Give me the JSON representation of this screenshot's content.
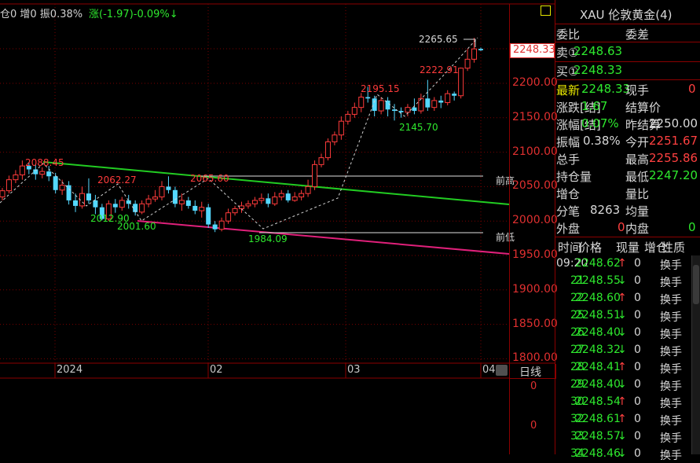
{
  "top_bar": {
    "text1": "仓0 增0 振0.38%",
    "text2": "涨(-1.97)-0.09%↓"
  },
  "price_axis": {
    "ticks": [
      "2200.00",
      "2150.00",
      "2100.00",
      "2050.00",
      "2000.00",
      "1950.00",
      "1900.00",
      "1850.00",
      "1800.00"
    ],
    "current_price": "2248.33",
    "lower_ticks": [
      "0",
      "0"
    ]
  },
  "date_axis": {
    "labels": [
      "2024",
      "02",
      "03",
      "04"
    ],
    "period_label": "日线"
  },
  "chart_annotations": {
    "high_label": "2265.65",
    "peak_labels": [
      "2222.91",
      "2195.15",
      "2088.45",
      "2062.27",
      "2065.60"
    ],
    "trough_labels": [
      "2145.70",
      "2012.90",
      "2001.60",
      "1984.09"
    ],
    "line_tags": [
      "前高",
      "前低"
    ]
  },
  "candles": [
    {
      "o": 2035,
      "c": 2044,
      "h": 2048,
      "l": 2030
    },
    {
      "o": 2044,
      "c": 2060,
      "h": 2066,
      "l": 2040
    },
    {
      "o": 2060,
      "c": 2067,
      "h": 2074,
      "l": 2055
    },
    {
      "o": 2067,
      "c": 2080,
      "h": 2088,
      "l": 2060
    },
    {
      "o": 2080,
      "c": 2075,
      "h": 2085,
      "l": 2068
    },
    {
      "o": 2075,
      "c": 2068,
      "h": 2082,
      "l": 2060
    },
    {
      "o": 2068,
      "c": 2072,
      "h": 2078,
      "l": 2062
    },
    {
      "o": 2072,
      "c": 2065,
      "h": 2080,
      "l": 2058
    },
    {
      "o": 2065,
      "c": 2045,
      "h": 2070,
      "l": 2040
    },
    {
      "o": 2045,
      "c": 2052,
      "h": 2060,
      "l": 2038
    },
    {
      "o": 2052,
      "c": 2030,
      "h": 2058,
      "l": 2024
    },
    {
      "o": 2030,
      "c": 2022,
      "h": 2040,
      "l": 2013
    },
    {
      "o": 2022,
      "c": 2040,
      "h": 2050,
      "l": 2018
    },
    {
      "o": 2040,
      "c": 2030,
      "h": 2062,
      "l": 2025
    },
    {
      "o": 2030,
      "c": 2020,
      "h": 2038,
      "l": 2010
    },
    {
      "o": 2020,
      "c": 2003,
      "h": 2025,
      "l": 2001
    },
    {
      "o": 2003,
      "c": 2025,
      "h": 2030,
      "l": 2000
    },
    {
      "o": 2025,
      "c": 2020,
      "h": 2032,
      "l": 2012
    },
    {
      "o": 2020,
      "c": 2030,
      "h": 2035,
      "l": 2015
    },
    {
      "o": 2030,
      "c": 2025,
      "h": 2038,
      "l": 2018
    },
    {
      "o": 2025,
      "c": 2013,
      "h": 2030,
      "l": 2008
    },
    {
      "o": 2013,
      "c": 2025,
      "h": 2030,
      "l": 2010
    },
    {
      "o": 2025,
      "c": 2032,
      "h": 2038,
      "l": 2020
    },
    {
      "o": 2032,
      "c": 2035,
      "h": 2045,
      "l": 2028
    },
    {
      "o": 2035,
      "c": 2050,
      "h": 2058,
      "l": 2030
    },
    {
      "o": 2050,
      "c": 2045,
      "h": 2065,
      "l": 2040
    },
    {
      "o": 2045,
      "c": 2025,
      "h": 2050,
      "l": 2020
    },
    {
      "o": 2025,
      "c": 2030,
      "h": 2040,
      "l": 2015
    },
    {
      "o": 2030,
      "c": 2022,
      "h": 2035,
      "l": 2018
    },
    {
      "o": 2022,
      "c": 2015,
      "h": 2030,
      "l": 2010
    },
    {
      "o": 2015,
      "c": 2020,
      "h": 2028,
      "l": 2005
    },
    {
      "o": 2020,
      "c": 1995,
      "h": 2025,
      "l": 1990
    },
    {
      "o": 1995,
      "c": 1988,
      "h": 2000,
      "l": 1984
    },
    {
      "o": 1988,
      "c": 2000,
      "h": 2005,
      "l": 1985
    },
    {
      "o": 2000,
      "c": 2012,
      "h": 2018,
      "l": 1996
    },
    {
      "o": 2012,
      "c": 2018,
      "h": 2022,
      "l": 2008
    },
    {
      "o": 2018,
      "c": 2022,
      "h": 2028,
      "l": 2012
    },
    {
      "o": 2022,
      "c": 2025,
      "h": 2030,
      "l": 2018
    },
    {
      "o": 2025,
      "c": 2030,
      "h": 2035,
      "l": 2020
    },
    {
      "o": 2030,
      "c": 2033,
      "h": 2040,
      "l": 2025
    },
    {
      "o": 2033,
      "c": 2025,
      "h": 2040,
      "l": 2020
    },
    {
      "o": 2025,
      "c": 2035,
      "h": 2042,
      "l": 2022
    },
    {
      "o": 2035,
      "c": 2040,
      "h": 2045,
      "l": 2030
    },
    {
      "o": 2040,
      "c": 2030,
      "h": 2045,
      "l": 2027
    },
    {
      "o": 2030,
      "c": 2035,
      "h": 2042,
      "l": 2028
    },
    {
      "o": 2035,
      "c": 2040,
      "h": 2045,
      "l": 2030
    },
    {
      "o": 2040,
      "c": 2050,
      "h": 2060,
      "l": 2035
    },
    {
      "o": 2050,
      "c": 2082,
      "h": 2088,
      "l": 2045
    },
    {
      "o": 2082,
      "c": 2092,
      "h": 2098,
      "l": 2078
    },
    {
      "o": 2092,
      "c": 2115,
      "h": 2120,
      "l": 2088
    },
    {
      "o": 2115,
      "c": 2125,
      "h": 2130,
      "l": 2110
    },
    {
      "o": 2125,
      "c": 2145,
      "h": 2152,
      "l": 2118
    },
    {
      "o": 2145,
      "c": 2155,
      "h": 2160,
      "l": 2140
    },
    {
      "o": 2155,
      "c": 2165,
      "h": 2172,
      "l": 2150
    },
    {
      "o": 2165,
      "c": 2180,
      "h": 2186,
      "l": 2158
    },
    {
      "o": 2180,
      "c": 2178,
      "h": 2195,
      "l": 2172
    },
    {
      "o": 2178,
      "c": 2160,
      "h": 2182,
      "l": 2152
    },
    {
      "o": 2160,
      "c": 2175,
      "h": 2180,
      "l": 2155
    },
    {
      "o": 2175,
      "c": 2162,
      "h": 2180,
      "l": 2152
    },
    {
      "o": 2162,
      "c": 2160,
      "h": 2170,
      "l": 2146
    },
    {
      "o": 2160,
      "c": 2158,
      "h": 2165,
      "l": 2150
    },
    {
      "o": 2158,
      "c": 2165,
      "h": 2170,
      "l": 2152
    },
    {
      "o": 2165,
      "c": 2160,
      "h": 2178,
      "l": 2155
    },
    {
      "o": 2160,
      "c": 2178,
      "h": 2185,
      "l": 2156
    },
    {
      "o": 2178,
      "c": 2165,
      "h": 2205,
      "l": 2160
    },
    {
      "o": 2165,
      "c": 2175,
      "h": 2180,
      "l": 2160
    },
    {
      "o": 2175,
      "c": 2172,
      "h": 2182,
      "l": 2164
    },
    {
      "o": 2172,
      "c": 2185,
      "h": 2190,
      "l": 2168
    },
    {
      "o": 2185,
      "c": 2182,
      "h": 2188,
      "l": 2175
    },
    {
      "o": 2182,
      "c": 2222,
      "h": 2223,
      "l": 2178
    },
    {
      "o": 2222,
      "c": 2235,
      "h": 2250,
      "l": 2218
    },
    {
      "o": 2235,
      "c": 2250,
      "h": 2266,
      "l": 2230
    },
    {
      "o": 2250,
      "c": 2248,
      "h": 2252,
      "l": 2247
    }
  ],
  "right_panel": {
    "title": "XAU 伦敦黄金(4)",
    "header_left": "委比",
    "header_right": "委差",
    "sell_label": "卖①",
    "sell_value": "2248.63",
    "buy_label": "买①",
    "buy_value": "2248.33",
    "stats": [
      {
        "k1": "最新",
        "v1": "2248.33",
        "k2": "现手",
        "v2": "0"
      },
      {
        "k1": "涨跌[结]",
        "v1": "1.67",
        "k2": "结算价",
        "v2": ""
      },
      {
        "k1": "涨幅[结]",
        "v1": "0.07%",
        "k2": "昨结算",
        "v2": "2250.00"
      },
      {
        "k1": "振幅",
        "v1": "0.38%",
        "k2": "今开",
        "v2": "2251.67"
      },
      {
        "k1": "总手",
        "v1": "",
        "k2": "最高",
        "v2": "2255.86"
      },
      {
        "k1": "持仓量",
        "v1": "",
        "k2": "最低",
        "v2": "2247.20"
      },
      {
        "k1": "增仓",
        "v1": "",
        "k2": "量比",
        "v2": ""
      },
      {
        "k1": "分笔",
        "v1": "8263",
        "k2": "均量",
        "v2": ""
      },
      {
        "k1": "外盘",
        "v1": "0",
        "k2": "内盘",
        "v2": "0"
      }
    ],
    "ticks_header": [
      "时间",
      "价格",
      "现量",
      "增仓",
      "性质"
    ],
    "ticks": [
      {
        "time": "09:20",
        "price": "2248.62",
        "arrow": "↑",
        "vol": "0",
        "nature": "换手"
      },
      {
        "time": "21",
        "price": "2248.55",
        "arrow": "↓",
        "vol": "0",
        "nature": "换手"
      },
      {
        "time": "22",
        "price": "2248.60",
        "arrow": "↑",
        "vol": "0",
        "nature": "换手"
      },
      {
        "time": "25",
        "price": "2248.51",
        "arrow": "↓",
        "vol": "0",
        "nature": "换手"
      },
      {
        "time": "26",
        "price": "2248.40",
        "arrow": "↓",
        "vol": "0",
        "nature": "换手"
      },
      {
        "time": "27",
        "price": "2248.32",
        "arrow": "↓",
        "vol": "0",
        "nature": "换手"
      },
      {
        "time": "28",
        "price": "2248.41",
        "arrow": "↑",
        "vol": "0",
        "nature": "换手"
      },
      {
        "time": "29",
        "price": "2248.40",
        "arrow": "↓",
        "vol": "0",
        "nature": "换手"
      },
      {
        "time": "30",
        "price": "2248.54",
        "arrow": "↑",
        "vol": "0",
        "nature": "换手"
      },
      {
        "time": "32",
        "price": "2248.61",
        "arrow": "↑",
        "vol": "0",
        "nature": "换手"
      },
      {
        "time": "33",
        "price": "2248.57",
        "arrow": "↓",
        "vol": "0",
        "nature": "换手"
      },
      {
        "time": "34",
        "price": "2248.46",
        "arrow": "↓",
        "vol": "0",
        "nature": "换手"
      }
    ]
  }
}
